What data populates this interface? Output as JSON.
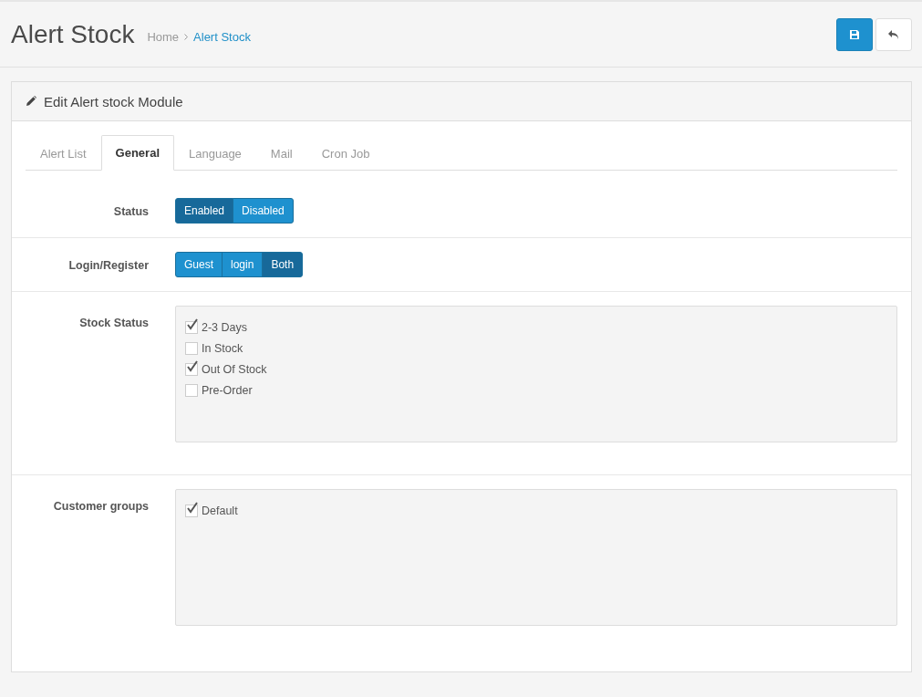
{
  "header": {
    "title": "Alert Stock",
    "breadcrumb": [
      {
        "label": "Home",
        "selected": false
      },
      {
        "label": "Alert Stock",
        "selected": true
      }
    ]
  },
  "panel": {
    "title": "Edit Alert stock Module"
  },
  "tabs": [
    {
      "label": "Alert List",
      "selected": false
    },
    {
      "label": "General",
      "selected": true
    },
    {
      "label": "Language",
      "selected": false
    },
    {
      "label": "Mail",
      "selected": false
    },
    {
      "label": "Cron Job",
      "selected": false
    }
  ],
  "fields": [
    {
      "kind": "toggle",
      "label": "Status",
      "options": [
        {
          "label": "Enabled",
          "selected": true
        },
        {
          "label": "Disabled",
          "selected": false
        }
      ]
    },
    {
      "kind": "toggle",
      "label": "Login/Register",
      "options": [
        {
          "label": "Guest",
          "selected": false
        },
        {
          "label": "login",
          "selected": false
        },
        {
          "label": "Both",
          "selected": true
        }
      ]
    },
    {
      "kind": "checklist",
      "label": "Stock Status",
      "items": [
        {
          "label": "2-3 Days",
          "checked": true
        },
        {
          "label": "In Stock",
          "checked": false
        },
        {
          "label": "Out Of Stock",
          "checked": true
        },
        {
          "label": "Pre-Order",
          "checked": false
        }
      ]
    },
    {
      "kind": "checklist",
      "label": "Customer groups",
      "items": [
        {
          "label": "Default",
          "checked": true
        }
      ]
    }
  ]
}
